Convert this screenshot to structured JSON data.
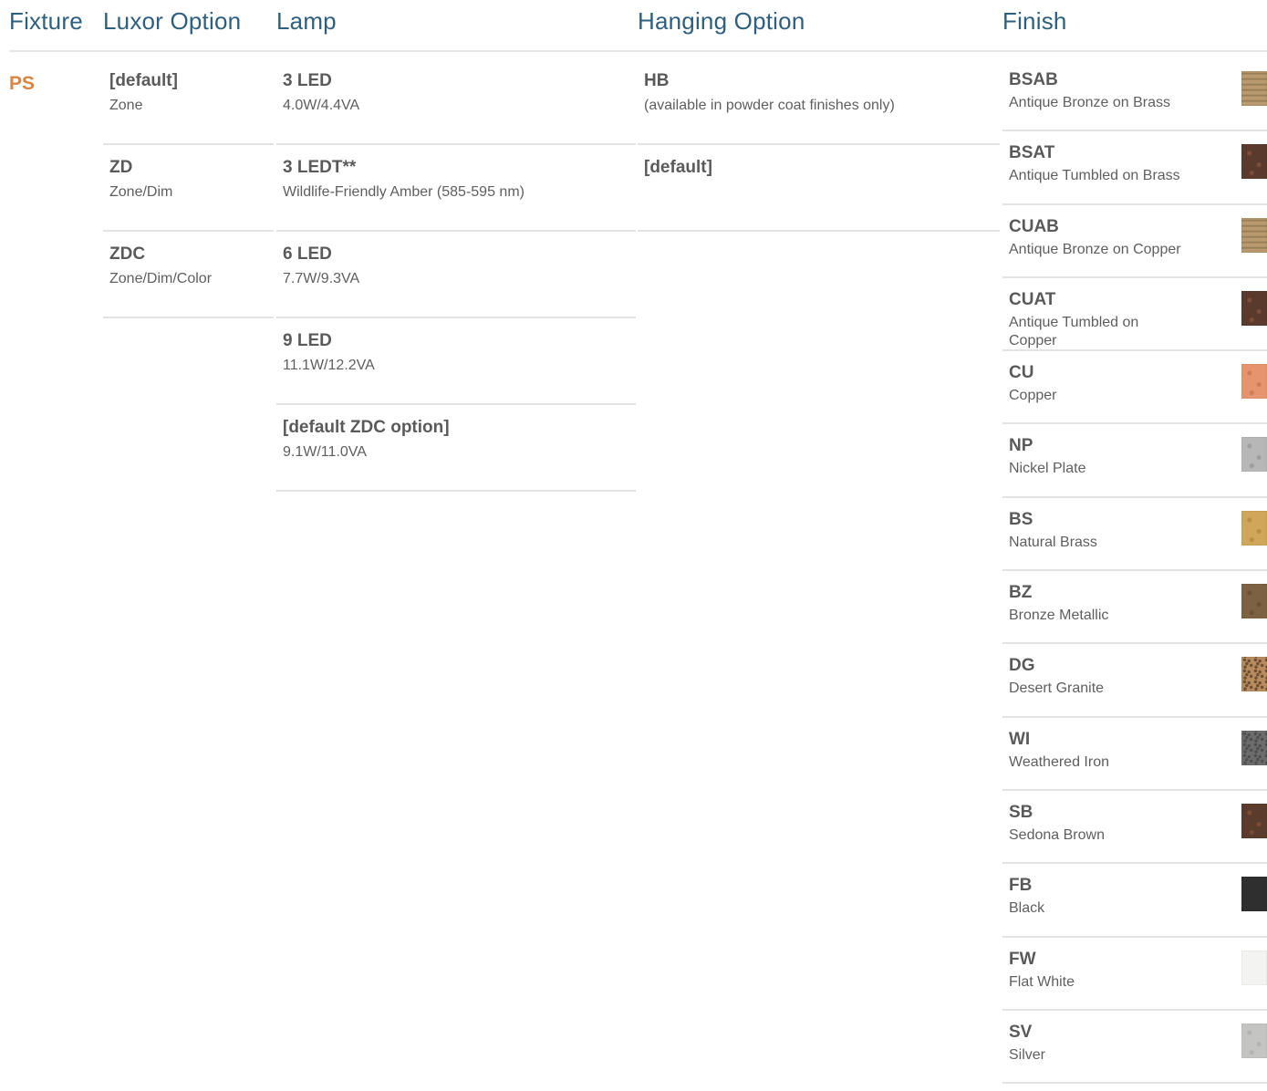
{
  "headers": {
    "fixture": "Fixture",
    "luxor": "Luxor Option",
    "lamp": "Lamp",
    "hanging": "Hanging Option",
    "finish": "Finish"
  },
  "fixture": {
    "code": "PS"
  },
  "luxor_options": [
    {
      "code": "[default]",
      "desc": "Zone"
    },
    {
      "code": "ZD",
      "desc": "Zone/Dim"
    },
    {
      "code": "ZDC",
      "desc": "Zone/Dim/Color"
    }
  ],
  "lamps": [
    {
      "code": "3 LED",
      "desc": "4.0W/4.4VA"
    },
    {
      "code": "3 LEDT**",
      "desc": "Wildlife-Friendly Amber (585-595 nm)"
    },
    {
      "code": "6 LED",
      "desc": "7.7W/9.3VA"
    },
    {
      "code": "9 LED",
      "desc": "11.1W/12.2VA"
    },
    {
      "code": "[default ZDC option]",
      "desc": "9.1W/11.0VA"
    }
  ],
  "hanging_options": [
    {
      "code": "HB",
      "desc": "(available in powder coat finishes only)"
    },
    {
      "code": "[default]",
      "desc": ""
    }
  ],
  "finishes": [
    {
      "code": "BSAB",
      "desc": "Antique Bronze on Brass",
      "swatch": "#b89a6e",
      "swatch2": "#8f7650",
      "texture": "wood"
    },
    {
      "code": "BSAT",
      "desc": "Antique Tumbled on Brass",
      "swatch": "#5a3a2c",
      "swatch2": "#7a4e38",
      "texture": "speckle"
    },
    {
      "code": "CUAB",
      "desc": "Antique Bronze on Copper",
      "swatch": "#b89a6e",
      "swatch2": "#8f7650",
      "texture": "wood"
    },
    {
      "code": "CUAT",
      "desc": "Antique Tumbled on Copper",
      "swatch": "#5a3a2c",
      "swatch2": "#7a4e38",
      "texture": "speckle"
    },
    {
      "code": "CU",
      "desc": "Copper",
      "swatch": "#e5946d",
      "swatch2": "#d07c58",
      "texture": "speckle"
    },
    {
      "code": "NP",
      "desc": "Nickel Plate",
      "swatch": "#b7b7b7",
      "swatch2": "#9e9e9e",
      "texture": "speckle"
    },
    {
      "code": "BS",
      "desc": "Natural Brass",
      "swatch": "#cfa65a",
      "swatch2": "#b98d44",
      "texture": "speckle"
    },
    {
      "code": "BZ",
      "desc": "Bronze Metallic",
      "swatch": "#7c6142",
      "swatch2": "#6a5236",
      "texture": "speckle"
    },
    {
      "code": "DG",
      "desc": "Desert Granite",
      "swatch": "#b88b5f",
      "swatch2": "#6e4f34",
      "texture": "granite"
    },
    {
      "code": "WI",
      "desc": "Weathered Iron",
      "swatch": "#6c6c6c",
      "swatch2": "#4f4f4f",
      "texture": "granite"
    },
    {
      "code": "SB",
      "desc": "Sedona Brown",
      "swatch": "#5a3b2c",
      "swatch2": "#7a4c36",
      "texture": "speckle"
    },
    {
      "code": "FB",
      "desc": "Black",
      "swatch": "#2f2f2f",
      "swatch2": "#2a2a2a",
      "texture": "flat"
    },
    {
      "code": "FW",
      "desc": "Flat White",
      "swatch": "#f3f3f1",
      "swatch2": "#efefec",
      "texture": "flat"
    },
    {
      "code": "SV",
      "desc": "Silver",
      "swatch": "#c4c4c2",
      "swatch2": "#b3b3b0",
      "texture": "speckle"
    }
  ]
}
